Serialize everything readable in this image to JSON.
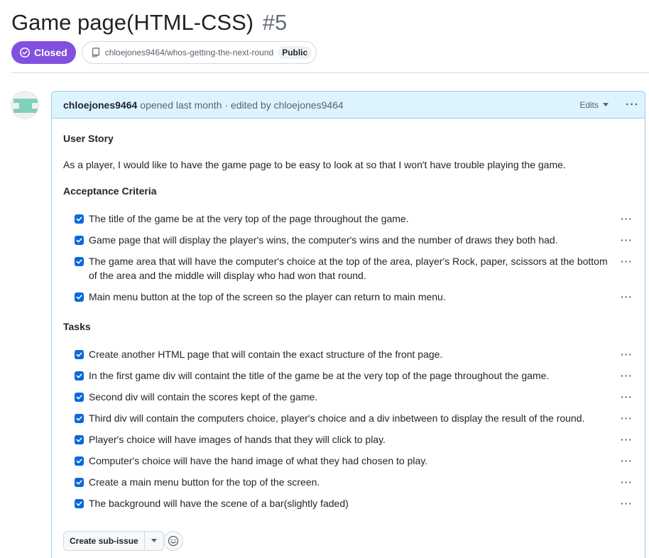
{
  "issue": {
    "title": "Game page(HTML-CSS)",
    "number": "#5",
    "state": "Closed",
    "repo": "chloejones9464/whos-getting-the-next-round",
    "visibility": "Public"
  },
  "comment": {
    "author": "chloejones9464",
    "meta": "opened last month · edited by chloejones9464",
    "edits_label": "Edits",
    "heading_user_story": "User Story",
    "user_story": "As a player, I would like to have the game page to be easy to look at so that I won't have trouble playing the game.",
    "heading_acceptance": "Acceptance Criteria",
    "acceptance": [
      "The title of the game be at the very top of the page throughout the game.",
      "Game page that will display the player's wins, the computer's wins and the number of draws they both had.",
      "The game area that will have the computer's choice at the top of the area, player's Rock, paper, scissors at the bottom of the area and the middle will display who had won that round.",
      "Main menu button at the top of the screen so the player can return to main menu."
    ],
    "heading_tasks": "Tasks",
    "tasks": [
      "Create another HTML page that will contain the exact structure of the front page.",
      "In the first game div will containt the title of the game be at the very top of the page throughout the game.",
      "Second div will contain the scores kept of the game.",
      "Third div will contain the computers choice, player's choice and a div inbetween to display the result of the round.",
      "Player's choice will have images of hands that they will click to play.",
      "Computer's choice will have the hand image of what they had chosen to play.",
      "Create a main menu button for the top of the screen.",
      "The background will have the scene of a bar(slightly faded)"
    ],
    "create_subissue_label": "Create sub-issue"
  },
  "colors": {
    "closed_badge": "#8250df",
    "checkbox": "#0969da",
    "header_bg": "#ddf4ff",
    "avatar_accent": "#7fd1b9"
  },
  "icons": [
    "check-circle-icon",
    "repo-icon",
    "chevron-down-icon",
    "kebab-icon",
    "checkbox-checked-icon",
    "smiley-icon"
  ]
}
